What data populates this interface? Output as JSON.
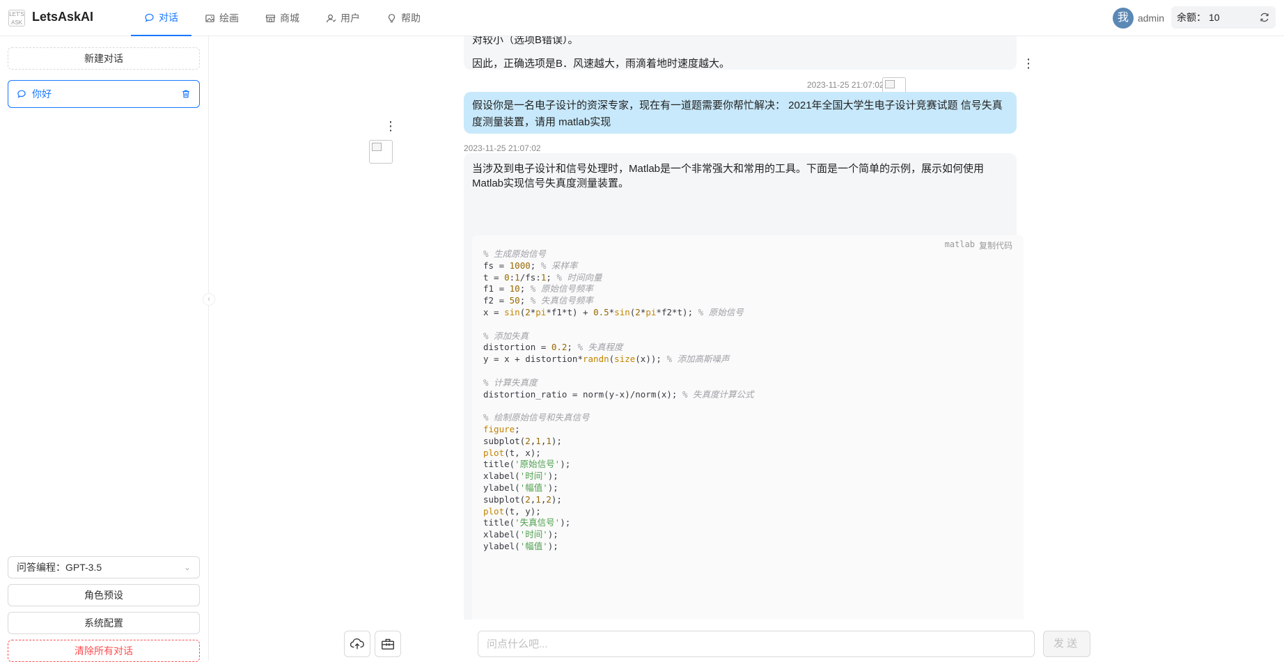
{
  "brand": {
    "name": "LetsAskAI",
    "logo_text": "LET'S ASK"
  },
  "nav": [
    {
      "label": "对话",
      "icon": "chat-icon",
      "active": true
    },
    {
      "label": "绘画",
      "icon": "image-icon",
      "active": false
    },
    {
      "label": "商城",
      "icon": "shop-icon",
      "active": false
    },
    {
      "label": "用户",
      "icon": "user-icon",
      "active": false
    },
    {
      "label": "帮助",
      "icon": "bulb-icon",
      "active": false
    }
  ],
  "user": {
    "avatar_char": "我",
    "name": "admin"
  },
  "balance": {
    "label": "余额：",
    "value": "10"
  },
  "sidebar": {
    "new_chat": "新建对话",
    "conversations": [
      {
        "title": "你好"
      }
    ],
    "model_select": "问答编程：GPT-3.5",
    "role_preset": "角色预设",
    "system_config": "系统配置",
    "clear_all": "清除所有对话"
  },
  "messages": {
    "prev_answer": {
      "line1": "对较小（选项B错误）。",
      "line2": "因此，正确选项是B．风速越大，雨滴着地时速度越大。"
    },
    "question": {
      "time": "2023-11-25 21:07:02",
      "text": "假设你是一名电子设计的资深专家，现在有一道题需要你帮忙解决： 2021年全国大学生电子设计竞赛试题 信号失真度测量装置，请用 matlab实现"
    },
    "answer": {
      "time": "2023-11-25 21:07:02",
      "intro": "当涉及到电子设计和信号处理时，Matlab是一个非常强大和常用的工具。下面是一个简单的示例，展示如何使用Matlab实现信号失真度测量装置。",
      "code_lang": "matlab",
      "copy_label": "复制代码",
      "code_lines": [
        "% 生成原始信号",
        "fs = 1000; % 采样率",
        "t = 0:1/fs:1; % 时间向量",
        "f1 = 10; % 原始信号频率",
        "f2 = 50; % 失真信号频率",
        "x = sin(2*pi*f1*t) + 0.5*sin(2*pi*f2*t); % 原始信号",
        "",
        "% 添加失真",
        "distortion = 0.2; % 失真程度",
        "y = x + distortion*randn(size(x)); % 添加高斯噪声",
        "",
        "% 计算失真度",
        "distortion_ratio = norm(y-x)/norm(x); % 失真度计算公式",
        "",
        "% 绘制原始信号和失真信号",
        "figure;",
        "subplot(2,1,1);",
        "plot(t, x);",
        "title('原始信号');",
        "xlabel('时间');",
        "ylabel('幅值');",
        "subplot(2,1,2);",
        "plot(t, y);",
        "title('失真信号');",
        "xlabel('时间');",
        "ylabel('幅值');"
      ]
    }
  },
  "input": {
    "placeholder": "问点什么吧...",
    "send": "发送"
  },
  "colors": {
    "accent": "#1677ff",
    "user_bubble": "#c8e9fb",
    "bot_bubble": "#f4f6f8",
    "danger": "#ff4d4f"
  }
}
